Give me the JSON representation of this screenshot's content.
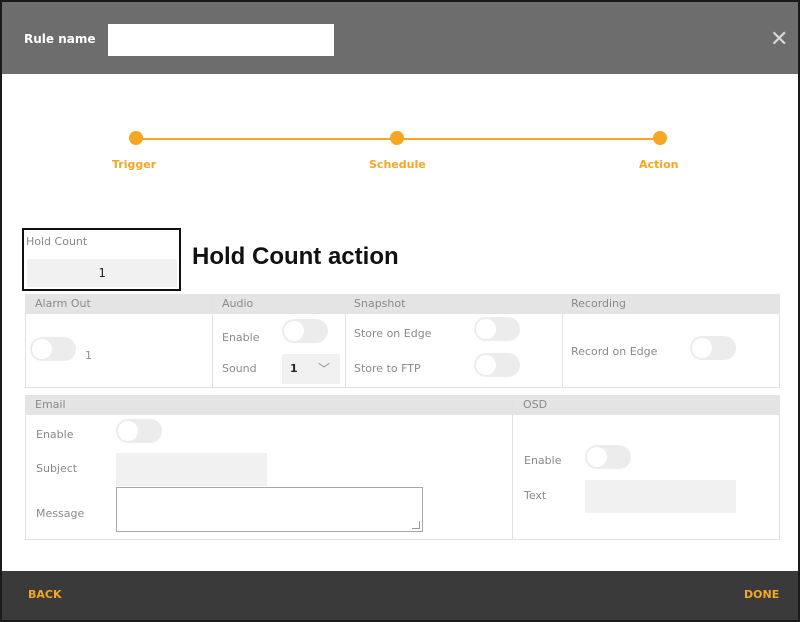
{
  "header": {
    "rule_name_label": "Rule name",
    "rule_name_value": "",
    "close_icon": "close-icon"
  },
  "stepper": {
    "steps": [
      "Trigger",
      "Schedule",
      "Action"
    ],
    "color": "#f5a623"
  },
  "hold_count": {
    "label": "Hold Count",
    "value": "1"
  },
  "annotation": "Hold Count action",
  "alarm_out": {
    "title": "Alarm Out",
    "value": "1"
  },
  "audio": {
    "title": "Audio",
    "enable_label": "Enable",
    "sound_label": "Sound",
    "sound_value": "1"
  },
  "snapshot": {
    "title": "Snapshot",
    "edge_label": "Store on Edge",
    "ftp_label": "Store to FTP"
  },
  "recording": {
    "title": "Recording",
    "edge_label": "Record on Edge"
  },
  "email": {
    "title": "Email",
    "enable_label": "Enable",
    "subject_label": "Subject",
    "message_label": "Message"
  },
  "osd": {
    "title": "OSD",
    "enable_label": "Enable",
    "text_label": "Text"
  },
  "footer": {
    "back_label": "BACK",
    "done_label": "DONE"
  }
}
